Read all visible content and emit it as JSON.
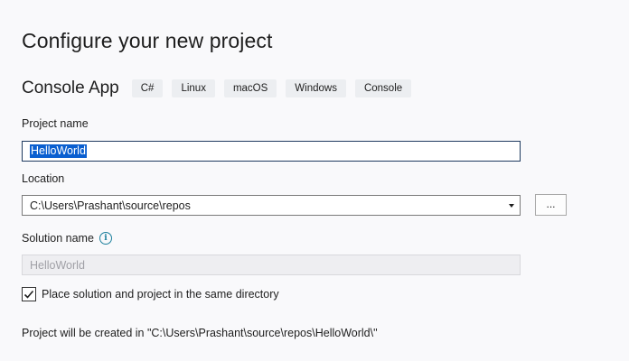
{
  "page": {
    "title": "Configure your new project"
  },
  "template": {
    "name": "Console App",
    "tags": [
      "C#",
      "Linux",
      "macOS",
      "Windows",
      "Console"
    ]
  },
  "project_name": {
    "label": "Project name",
    "value": "HelloWorld"
  },
  "location": {
    "label": "Location",
    "value": "C:\\Users\\Prashant\\source\\repos",
    "browse_label": "..."
  },
  "solution_name": {
    "label": "Solution name",
    "value": "HelloWorld",
    "info_icon": "info-icon"
  },
  "same_directory": {
    "label": "Place solution and project in the same directory",
    "checked": true
  },
  "footer": {
    "created_in": "Project will be created in \"C:\\Users\\Prashant\\source\\repos\\HelloWorld\\\""
  },
  "colors": {
    "selection": "#0a5fd0",
    "info": "#1b7f9c",
    "focus_border": "#1e3a5f"
  }
}
